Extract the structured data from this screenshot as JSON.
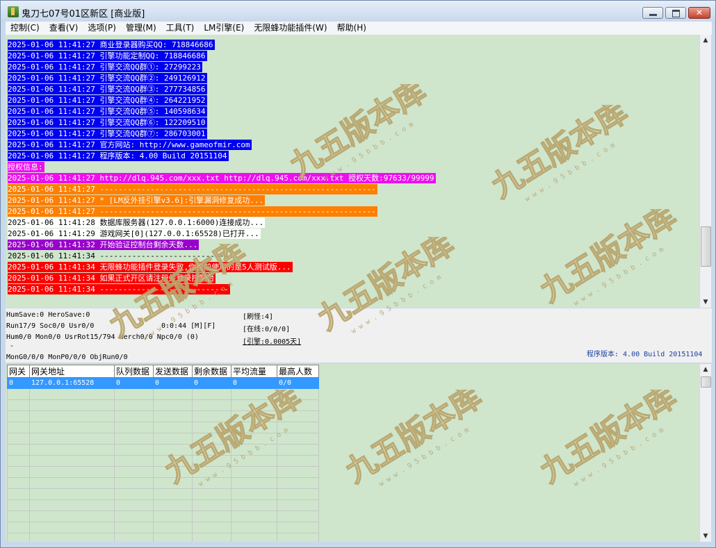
{
  "window": {
    "title": "鬼刀七07号01区新区 [商业版]"
  },
  "menu": [
    "控制(C)",
    "查看(V)",
    "选项(P)",
    "管理(M)",
    "工具(T)",
    "LM引擎(E)",
    "无限蜂功能插件(W)",
    "帮助(H)"
  ],
  "log": [
    {
      "text": "2025-01-06 11:41:27 商业登录器购买QQ: 718846686",
      "style": "blue"
    },
    {
      "text": "2025-01-06 11:41:27 引擎功能定制QQ: 718846686",
      "style": "blue"
    },
    {
      "text": "2025-01-06 11:41:27 引擎交流QQ群①: 27299223",
      "style": "blue"
    },
    {
      "text": "2025-01-06 11:41:27 引擎交流QQ群②: 249126912",
      "style": "blue"
    },
    {
      "text": "2025-01-06 11:41:27 引擎交流QQ群③: 277734856",
      "style": "blue"
    },
    {
      "text": "2025-01-06 11:41:27 引擎交流QQ群④: 264221952",
      "style": "blue"
    },
    {
      "text": "2025-01-06 11:41:27 引擎交流QQ群⑤: 140598634",
      "style": "blue"
    },
    {
      "text": "2025-01-06 11:41:27 引擎交流QQ群⑥: 122209510",
      "style": "blue"
    },
    {
      "text": "2025-01-06 11:41:27 引擎交流QQ群⑦: 286703001",
      "style": "blue"
    },
    {
      "text": "2025-01-06 11:41:27 官方网站: http://www.gameofmir.com",
      "style": "blue"
    },
    {
      "text": "2025-01-06 11:41:27 程序版本: 4.00 Build 20151104",
      "style": "blue"
    },
    {
      "text": "授权信息:",
      "style": "magenta"
    },
    {
      "text": "2025-01-06 11:41:27 http://dlq.945.com/xxx.txt http://dlq.945.com/xxx.txt 授权天数:97633/99999",
      "style": "magenta"
    },
    {
      "text": "2025-01-06 11:41:27 ------------------------------------------------------------",
      "style": "orange"
    },
    {
      "text": "2025-01-06 11:41:27 * [LM反外挂引擎v3.6]:引擎漏洞修复成功...",
      "style": "orange"
    },
    {
      "text": "2025-01-06 11:41:27 ------------------------------------------------------------",
      "style": "orange"
    },
    {
      "text": "2025-01-06 11:41:28 数据库服务器(127.0.0.1:6000)连接成功...",
      "style": "white"
    },
    {
      "text": "2025-01-06 11:41:29 游戏网关[0](127.0.0.1:65528)已打开...",
      "style": "white"
    },
    {
      "text": "2025-01-06 11:41:32 开始验证控制台剩余天数...",
      "style": "purple"
    },
    {
      "text": "2025-01-06 11:41:34 ----------------------------",
      "style": "none"
    },
    {
      "text": "2025-01-06 11:41:34 无限蜂功能插件登录失败,你目前使用的是5人测试版...",
      "style": "red"
    },
    {
      "text": "2025-01-06 11:41:34 如果正式开区请注册并登录控制台",
      "style": "red"
    },
    {
      "text": "2025-01-06 11:41:34 ----------------------------",
      "style": "red"
    }
  ],
  "status": {
    "line1": "HumSave:0 HeroSave:0",
    "line2": "Run17/9 Soc0/0 Usr0/0",
    "timer": "0:0:44 [M][F]",
    "line3": "Hum0/0 Mon0/0 UsrRot15/794 Merch0/0 Npc0/0 (0)",
    "dash": "-",
    "line4": "MonG0/0/0 MonP0/0/0 ObjRun0/0",
    "refresh": "[刷怪:4]",
    "online": "[在线:0/0/0]",
    "engine": "[引擎:0.0005天]",
    "version": "程序版本: 4.00 Build 20151104"
  },
  "grid": {
    "columns": [
      "网关",
      "网关地址",
      "队列数据",
      "发送数据",
      "剩余数据",
      "平均流量",
      "最高人数"
    ],
    "rows": [
      [
        "0",
        "127.0.0.1:65528",
        "0",
        "0",
        "0",
        "0",
        "0/0"
      ]
    ]
  },
  "watermark": {
    "title": "九五版本库",
    "url": "w w w . 9 5 b b b . c o m"
  },
  "colors": {
    "log_bg": "#cfe6cd",
    "blue": "#0000f0",
    "magenta": "#ee10ee",
    "orange": "#ff7f00",
    "purple": "#9900cc",
    "red": "#ff0000",
    "selected_row": "#3399ff"
  }
}
